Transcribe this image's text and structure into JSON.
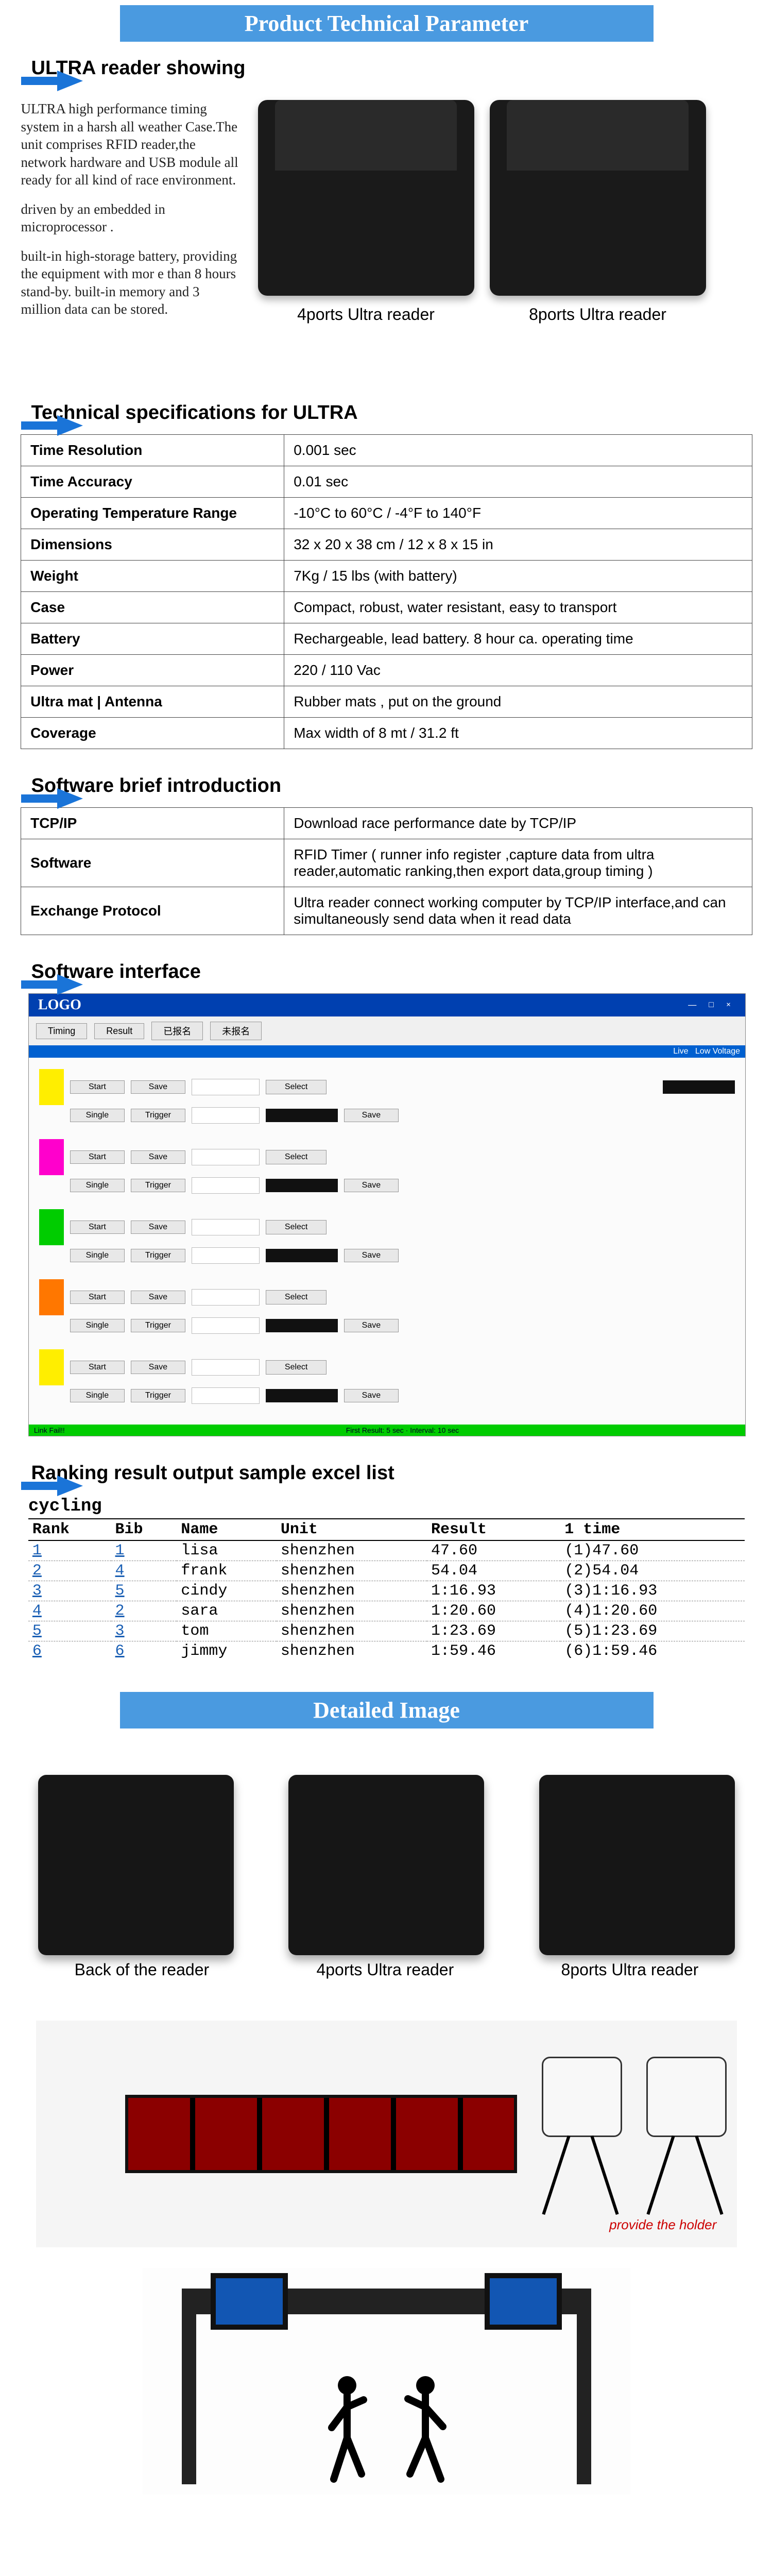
{
  "banners": {
    "tech_param": "Product Technical Parameter",
    "detailed_image": "Detailed Image"
  },
  "headings": {
    "ultra_showing": "ULTRA reader showing",
    "tech_spec": "Technical specifications for ULTRA",
    "soft_intro": "Software brief introduction",
    "soft_iface": "Software interface",
    "ranking": "Ranking result output sample excel list"
  },
  "intro": {
    "p1": "ULTRA high performance timing system in a harsh all weather Case.The unit comprises RFID reader,the network hardware and USB module all  ready for all kind of race environment.",
    "p2": "driven by an embedded in microprocessor .",
    "p3": "built-in high-storage battery, providing the equipment with mor e than 8 hours stand-by. built-in memory and 3 million data can be stored."
  },
  "reader_labels": {
    "four": "4ports Ultra reader",
    "eight": "8ports Ultra reader",
    "back": "Back of the reader"
  },
  "spec_rows": [
    {
      "k": "Time Resolution",
      "v": "0.001 sec"
    },
    {
      "k": "Time Accuracy",
      "v": "0.01 sec"
    },
    {
      "k": "Operating Temperature Range",
      "v": "-10°C to 60°C / -4°F to 140°F"
    },
    {
      "k": "Dimensions",
      "v": "32 x 20 x 38 cm / 12 x 8 x 15 in"
    },
    {
      "k": "Weight",
      "v": "7Kg / 15 lbs (with battery)"
    },
    {
      "k": "Case",
      "v": "Compact, robust, water resistant, easy to transport"
    },
    {
      "k": "Battery",
      "v": "Rechargeable, lead battery. 8 hour ca. operating time"
    },
    {
      "k": "Power",
      "v": "220 / 110 Vac"
    },
    {
      "k": "Ultra mat | Antenna",
      "v": "Rubber mats , put on the ground"
    },
    {
      "k": "Coverage",
      "v": "Max width of 8 mt / 31.2 ft"
    }
  ],
  "soft_rows": [
    {
      "k": "TCP/IP",
      "v": "Download race performance date by TCP/IP"
    },
    {
      "k": "Software",
      "v": " RFID Timer ( runner info register ,capture data from ultra reader,automatic ranking,then export data,group timing )"
    },
    {
      "k": "Exchange Protocol",
      "v": "Ultra reader connect working computer by TCP/IP interface,and can simultaneously send data when it read data"
    }
  ],
  "sw_ui": {
    "logo": "LOGO",
    "toolbar": [
      "Timing",
      "Result",
      "已报名",
      "未报名"
    ],
    "status_r": [
      "Live",
      "Low Voltage"
    ],
    "row_btns": [
      "Start",
      "Save",
      "Select"
    ],
    "row2_btns": [
      "Single",
      "Trigger",
      "Save"
    ],
    "long_btn": "Select",
    "footer_l": "Link Fail!!",
    "footer_c": "First Result: 5 sec · Interval: 10 sec"
  },
  "ranking": {
    "title": "cycling",
    "headers": [
      "Rank",
      "Bib",
      "Name",
      "Unit",
      "Result",
      "1 time"
    ],
    "rows": [
      {
        "rank": "1",
        "bib": "1",
        "name": "lisa",
        "unit": "shenzhen",
        "result": "47.60",
        "t1": "(1)47.60"
      },
      {
        "rank": "2",
        "bib": "4",
        "name": "frank",
        "unit": "shenzhen",
        "result": "54.04",
        "t1": "(2)54.04"
      },
      {
        "rank": "3",
        "bib": "5",
        "name": "cindy",
        "unit": "shenzhen",
        "result": "1:16.93",
        "t1": "(3)1:16.93"
      },
      {
        "rank": "4",
        "bib": "2",
        "name": "sara",
        "unit": "shenzhen",
        "result": "1:20.60",
        "t1": "(4)1:20.60"
      },
      {
        "rank": "5",
        "bib": "3",
        "name": "tom",
        "unit": "shenzhen",
        "result": "1:23.69",
        "t1": "(5)1:23.69"
      },
      {
        "rank": "6",
        "bib": "6",
        "name": "jimmy",
        "unit": "shenzhen",
        "result": "1:59.46",
        "t1": "(6)1:59.46"
      }
    ]
  },
  "provide_holder": "provide the holder"
}
